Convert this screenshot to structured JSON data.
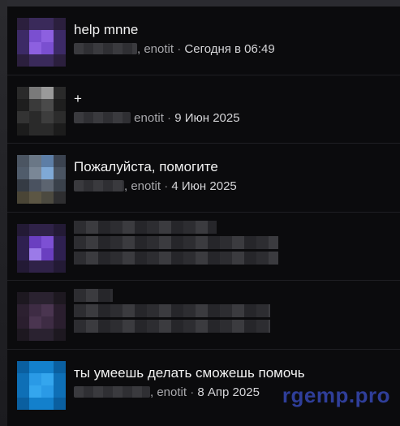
{
  "threads": [
    {
      "title": "help mnne",
      "author": "enotit",
      "date": "Сегодня в 06:49",
      "avatar_colors": [
        "#2b1f3d",
        "#3a2a5a",
        "#3a2a5a",
        "#2b1f3d",
        "#3c2a66",
        "#7a4fd0",
        "#8d60e0",
        "#3c2a66",
        "#3c2a66",
        "#8d60e0",
        "#7a4fd0",
        "#3c2a66",
        "#2b1f3d",
        "#3a2a5a",
        "#3a2a5a",
        "#2b1f3d"
      ]
    },
    {
      "title": "+",
      "author": "enotit",
      "date": "9 Июн 2025",
      "avatar_colors": [
        "#2a2a2a",
        "#7a7a7a",
        "#9a9a9a",
        "#2a2a2a",
        "#1e1e1e",
        "#3a3a3a",
        "#4a4a4a",
        "#1e1e1e",
        "#333333",
        "#2a2a2a",
        "#3d3d3d",
        "#2c2c2c",
        "#1c1c1c",
        "#2a2a2a",
        "#2a2a2a",
        "#1c1c1c"
      ]
    },
    {
      "title": "Пожалуйста, помогите",
      "author": "enotit",
      "date": "4 Июн 2025",
      "avatar_colors": [
        "#4b5562",
        "#6a7786",
        "#5d7ea6",
        "#3b4350",
        "#505c6b",
        "#7a8796",
        "#7fa9d6",
        "#4a5462",
        "#353b44",
        "#4a5260",
        "#5c6470",
        "#3a414b",
        "#4a4536",
        "#5c5644",
        "#4c4a40",
        "#2e2e30"
      ]
    },
    {
      "title": "",
      "author": "",
      "date": "",
      "avatar_colors": [
        "#231a35",
        "#2f2248",
        "#2f2248",
        "#231a35",
        "#2e2050",
        "#6a3fc0",
        "#7d50d4",
        "#2e2050",
        "#2e2050",
        "#9b7ae8",
        "#6a3fc0",
        "#2e2050",
        "#231a35",
        "#2f2248",
        "#2f2248",
        "#231a35"
      ]
    },
    {
      "title": "",
      "author": "",
      "date": "",
      "avatar_colors": [
        "#1d1820",
        "#2a2230",
        "#2a2230",
        "#1d1820",
        "#2c2030",
        "#3e2c44",
        "#4a3550",
        "#2a1e2e",
        "#2a1e2e",
        "#4a3550",
        "#3e2c44",
        "#2a1e2e",
        "#1d1820",
        "#2a2230",
        "#2a2230",
        "#1d1820"
      ]
    },
    {
      "title": "ты умеешь делать сможешь помочь",
      "author": "enotit",
      "date": "8 Апр 2025",
      "avatar_colors": [
        "#0a5fa0",
        "#1380cc",
        "#1380cc",
        "#0a5fa0",
        "#0e6fb6",
        "#2a9ae6",
        "#34a6ee",
        "#0e6fb6",
        "#0e6fb6",
        "#34a6ee",
        "#2a9ae6",
        "#0e6fb6",
        "#0a5fa0",
        "#1380cc",
        "#1380cc",
        "#0a5fa0"
      ]
    }
  ],
  "separator": " · ",
  "watermark": "rgemp.pro"
}
